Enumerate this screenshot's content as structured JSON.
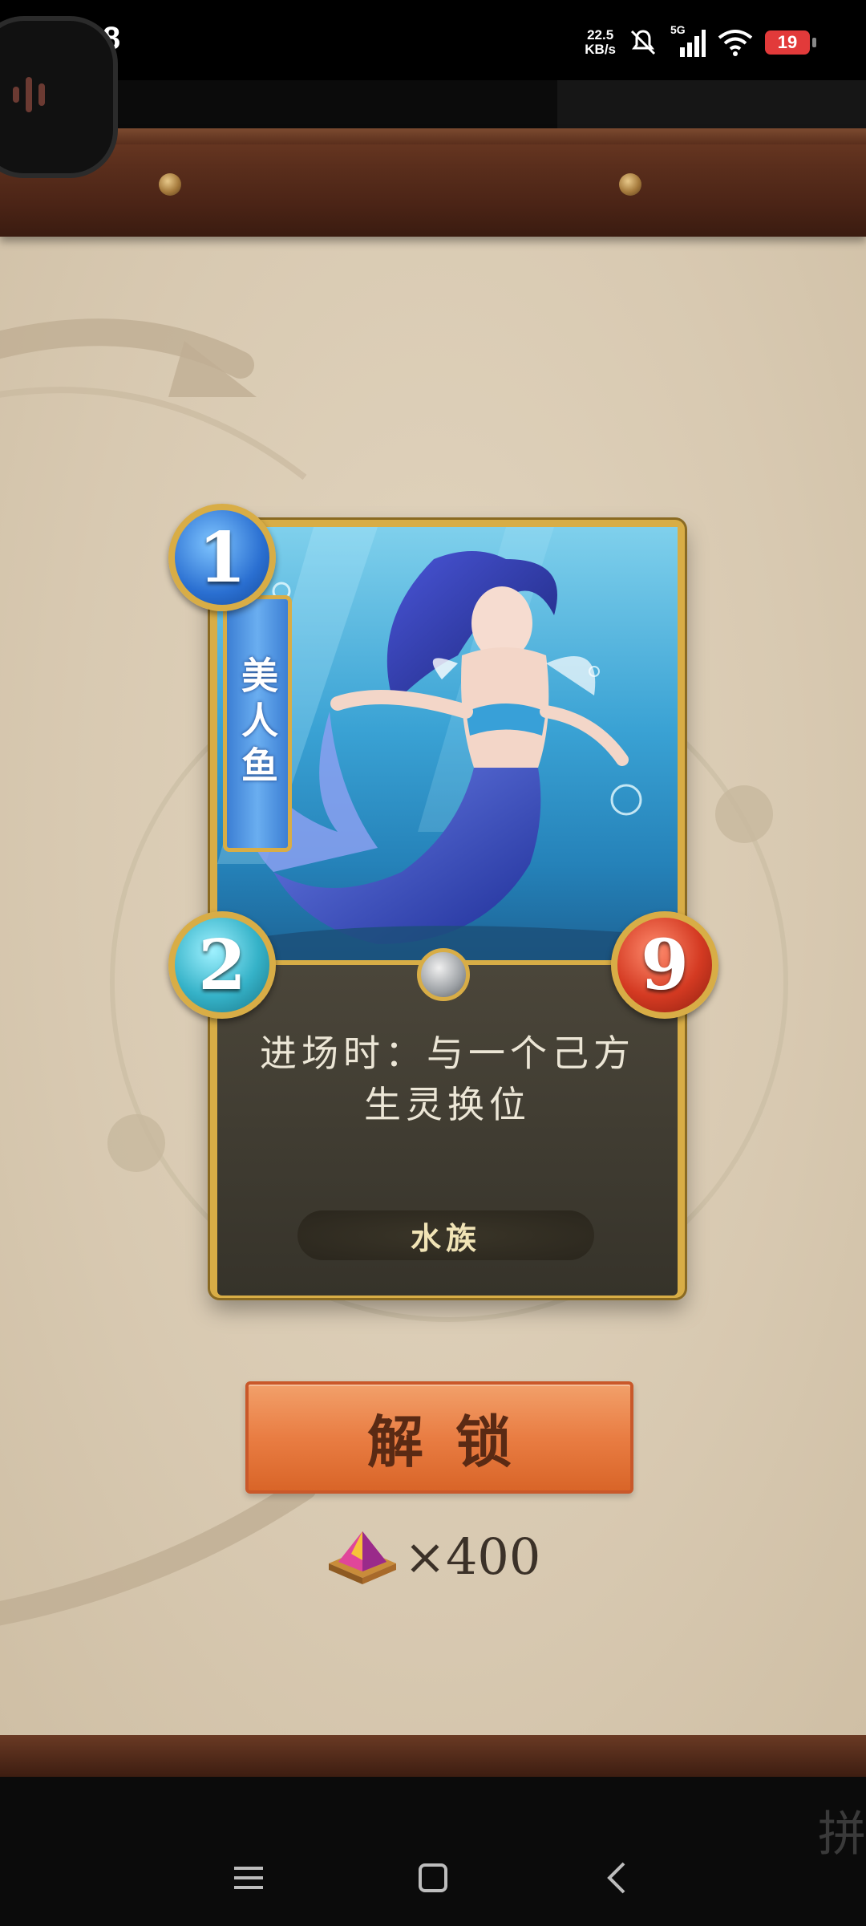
{
  "status_bar": {
    "time": "6:48",
    "net_speed_value": "22.5",
    "net_speed_unit": "KB/s",
    "network": "5G",
    "battery": "19",
    "battery_color": "#e23a3a"
  },
  "card": {
    "name": "美人鱼",
    "cost": "1",
    "attack": "2",
    "health": "9",
    "description": "进场时：与一个己方生灵换位",
    "race": "水族"
  },
  "unlock": {
    "button_label": "解锁",
    "cost_text": "×400"
  },
  "corner_text": "拼",
  "icons": [
    "mute-icon",
    "signal-icon",
    "wifi-icon",
    "battery-icon",
    "menu-icon",
    "home-icon",
    "back-icon",
    "crystal-icon"
  ],
  "colors": {
    "frame_gold": "#d8ad46",
    "button_orange": "#e97d43",
    "parchment": "#d8c9b1",
    "wood": "#5a2e1c"
  }
}
